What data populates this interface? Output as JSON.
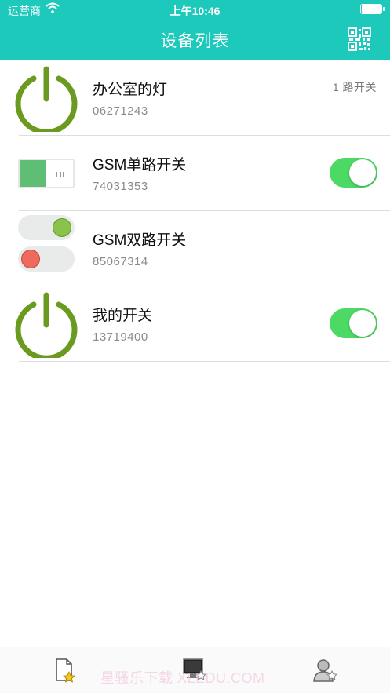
{
  "status_bar": {
    "carrier": "运营商",
    "time": "上午10:46"
  },
  "nav": {
    "title": "设备列表",
    "right_icon": "qr-code-icon"
  },
  "devices": [
    {
      "name": "办公室的灯",
      "id": "06271243",
      "channel_label": "1 路开关",
      "icon": "power-icon",
      "toggle": null
    },
    {
      "name": "GSM单路开关",
      "id": "74031353",
      "channel_label": "",
      "icon": "single-switch-icon",
      "toggle": true
    },
    {
      "name": "GSM双路开关",
      "id": "85067314",
      "channel_label": "",
      "icon": "double-switch-icon",
      "toggle": null
    },
    {
      "name": "我的开关",
      "id": "13719400",
      "channel_label": "",
      "icon": "power-icon",
      "toggle": true
    }
  ],
  "tab_bar": {
    "tabs": [
      {
        "icon": "favorites-icon"
      },
      {
        "icon": "device-monitor-icon"
      },
      {
        "icon": "account-icon"
      }
    ],
    "watermark": "星骚乐下载 XLEDU.COM"
  },
  "colors": {
    "header": "#1dc9bb",
    "power_icon": "#6a9a1f",
    "toggle_on": "#4cd964",
    "switch_on": "#5ebf74",
    "pill_green": "#8bc34a",
    "pill_red": "#ee6a5c"
  }
}
